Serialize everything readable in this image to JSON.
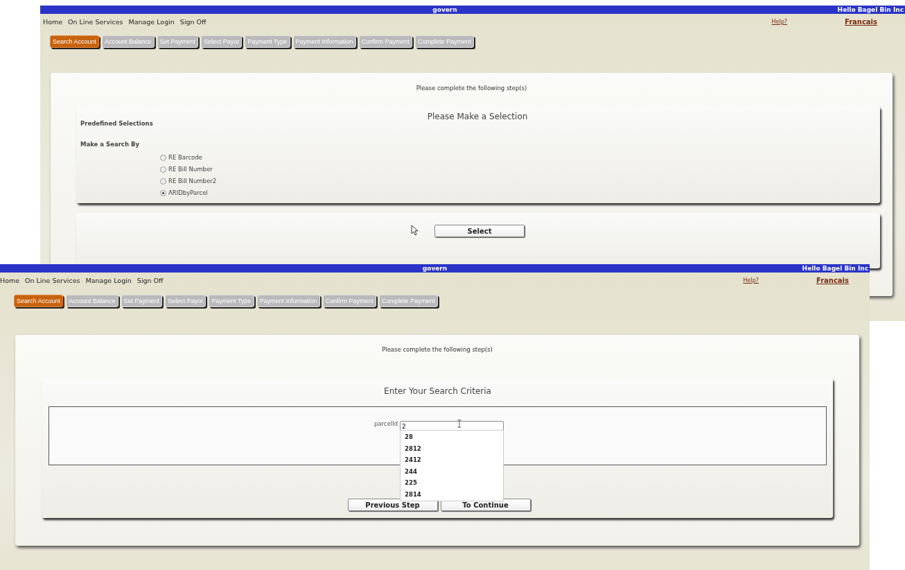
{
  "windows": [
    {
      "kind": "selection",
      "header": {
        "title": "govern",
        "greeting": "Hello Bagel Bin Inc"
      },
      "nav": [
        "Home",
        "On Line Services",
        "Manage Login",
        "Sign Off"
      ],
      "help": "Help?",
      "language": "Francais",
      "steps": [
        {
          "label": "Search Account",
          "selected": true
        },
        {
          "label": "Account Balance",
          "selected": false
        },
        {
          "label": "Set Payment",
          "selected": false
        },
        {
          "label": "Select Payor",
          "selected": false
        },
        {
          "label": "Payment Type",
          "selected": false
        },
        {
          "label": "Payment Information",
          "selected": false
        },
        {
          "label": "Confirm Payment",
          "selected": false
        },
        {
          "label": "Complete Payment",
          "selected": false
        }
      ],
      "instruction": "Please complete the following step(s)",
      "heading": "Please Make a Selection",
      "predefined_label": "Predefined Selections",
      "search_by_label": "Make a Search By",
      "options": [
        {
          "label": "RE Barcode",
          "selected": false
        },
        {
          "label": "RE Bill Number",
          "selected": false
        },
        {
          "label": "RE Bill Number2",
          "selected": false
        },
        {
          "label": "ARIDbyParcel",
          "selected": true
        }
      ],
      "button": "Select"
    },
    {
      "kind": "search",
      "header": {
        "title": "govern",
        "greeting": "Hello Bagel Bin Inc"
      },
      "nav": [
        "Home",
        "On Line Services",
        "Manage Login",
        "Sign Off"
      ],
      "help": "Help?",
      "language": "Francais",
      "steps": [
        {
          "label": "Search Account",
          "selected": true
        },
        {
          "label": "Account Balance",
          "selected": false
        },
        {
          "label": "Set Payment",
          "selected": false
        },
        {
          "label": "Select Payor",
          "selected": false
        },
        {
          "label": "Payment Type",
          "selected": false
        },
        {
          "label": "Payment Information",
          "selected": false
        },
        {
          "label": "Confirm Payment",
          "selected": false
        },
        {
          "label": "Complete Payment",
          "selected": false
        }
      ],
      "instruction": "Please complete the following step(s)",
      "heading": "Enter Your Search Criteria",
      "field": {
        "label": "parcelId",
        "value": "2"
      },
      "suggestions": [
        "28",
        "2812",
        "2412",
        "244",
        "225",
        "2814"
      ],
      "buttons": [
        "Previous Step",
        "To Continue"
      ]
    }
  ]
}
